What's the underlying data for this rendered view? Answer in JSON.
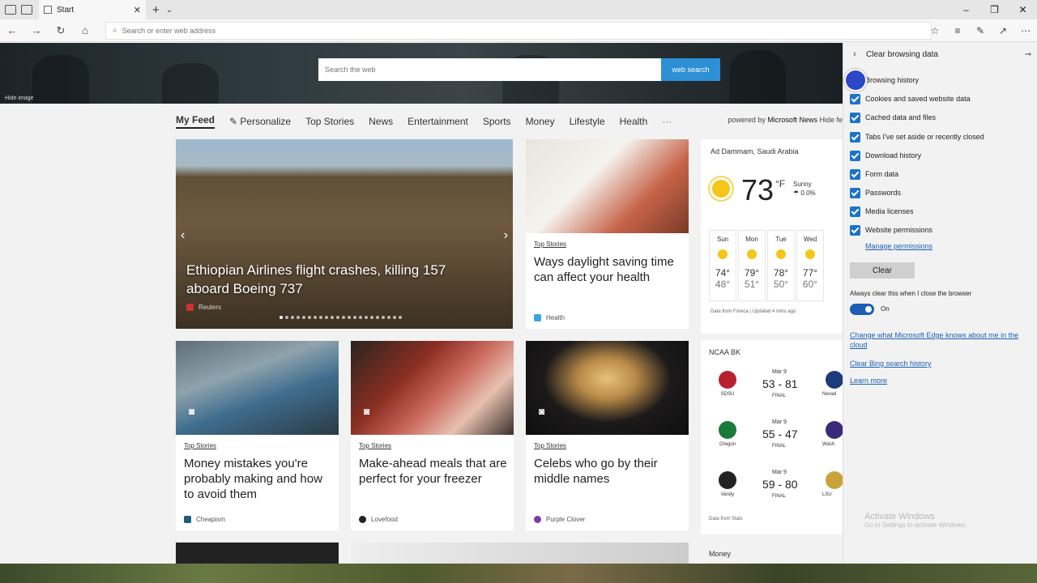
{
  "browser": {
    "tab_title": "Start",
    "address_placeholder": "Search or enter web address",
    "window_controls": [
      "–",
      "❐",
      "✕"
    ]
  },
  "hero": {
    "search_placeholder": "Search the web",
    "search_button": "web search",
    "hide_image": "Hide image"
  },
  "feed_nav": {
    "items": [
      "My Feed",
      "Personalize",
      "Top Stories",
      "News",
      "Entertainment",
      "Sports",
      "Money",
      "Lifestyle",
      "Health"
    ],
    "more": "···",
    "powered_prefix": "powered by",
    "powered_brand": "Microsoft News",
    "hide": "Hide fe"
  },
  "cards": {
    "main": {
      "headline": "Ethiopian Airlines flight crashes, killing 157 aboard Boeing 737",
      "source": "Reuters"
    },
    "daylight": {
      "category": "Top Stories",
      "headline": "Ways daylight saving time can affect your health",
      "source": "Health"
    },
    "money": {
      "category": "Top Stories",
      "headline": "Money mistakes you're probably making and how to avoid them",
      "source": "Cheapism"
    },
    "meals": {
      "category": "Top Stories",
      "headline": "Make-ahead meals that are perfect for your freezer",
      "source": "Lovefood"
    },
    "celebs": {
      "category": "Top Stories",
      "headline": "Celebs who go by their middle names",
      "source": "Purple Clover"
    }
  },
  "weather": {
    "location": "Ad Dammam, Saudi Arabia",
    "temp": "73",
    "unit": "°F",
    "condition": "Sunny",
    "precip": "0.0%",
    "days": [
      {
        "name": "Sun",
        "hi": "74°",
        "lo": "48°"
      },
      {
        "name": "Mon",
        "hi": "79°",
        "lo": "51°"
      },
      {
        "name": "Tue",
        "hi": "78°",
        "lo": "50°"
      },
      {
        "name": "Wed",
        "hi": "77°",
        "lo": "60°"
      }
    ],
    "credit": "Data from Foreca | Updated 4 mins ago"
  },
  "sports": {
    "header": "NCAA BK",
    "games": [
      {
        "date": "Mar 9",
        "score": "53 - 81",
        "status": "FINAL",
        "team1": "SDSU",
        "team2": "Nevad"
      },
      {
        "date": "Mar 9",
        "score": "55 - 47",
        "status": "FINAL",
        "team1": "Oregon",
        "team2": "Wash"
      },
      {
        "date": "Mar 9",
        "score": "59 - 80",
        "status": "FINAL",
        "team1": "Vandy",
        "team2": "LSU"
      }
    ],
    "credit": "Data from Stats"
  },
  "money_label": "Money",
  "panel": {
    "title": "Clear browsing data",
    "checkboxes": [
      "Browsing history",
      "Cookies and saved website data",
      "Cached data and files",
      "Tabs I've set aside or recently closed",
      "Download history",
      "Form data",
      "Passwords",
      "Media licenses",
      "Website permissions"
    ],
    "manage": "Manage permissions",
    "clear_button": "Clear",
    "always_clear": "Always clear this when I close the browser",
    "toggle_label": "On",
    "links": [
      "Change what Microsoft Edge knows about me in the cloud",
      "Clear Bing search history",
      "Learn more"
    ],
    "activate_title": "Activate Windows",
    "activate_sub": "Go to Settings to activate Windows."
  },
  "colors": {
    "accent": "#1a73c9",
    "search_button": "#2d8fd5",
    "link": "#1a5fb4"
  }
}
